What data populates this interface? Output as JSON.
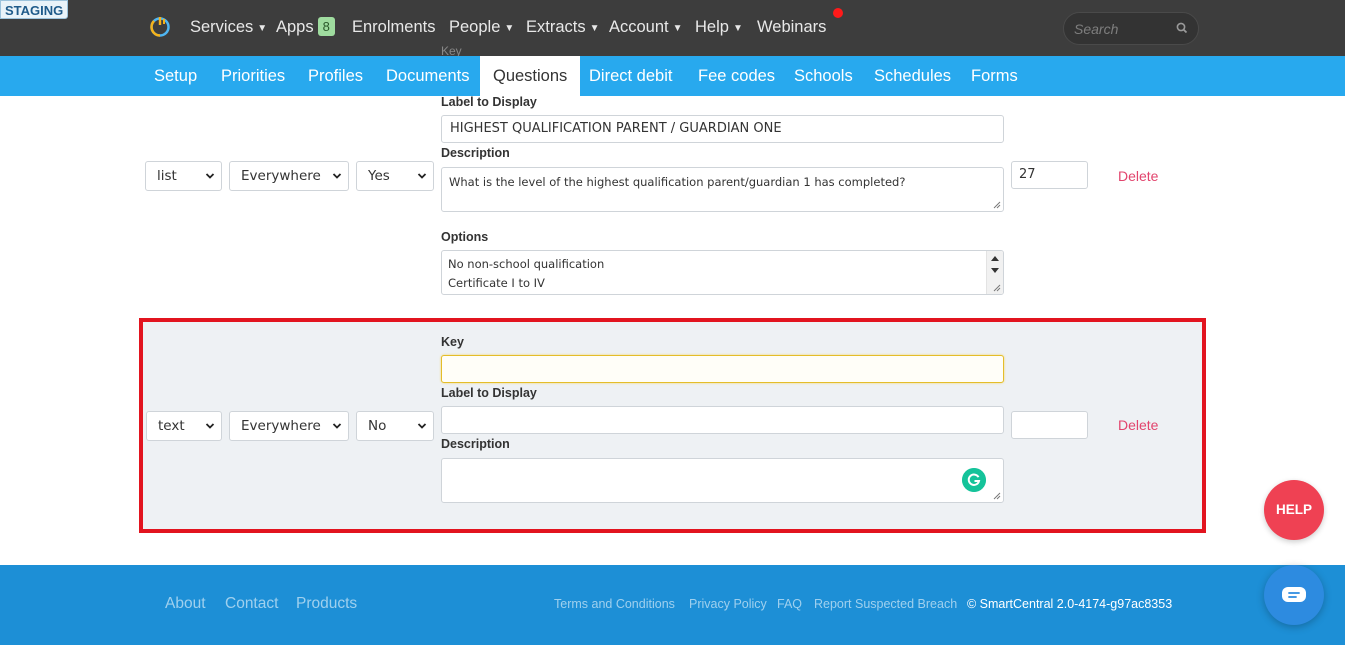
{
  "env_badge": "STAGING",
  "nav": {
    "items": [
      {
        "label": "Services",
        "caret": "▼"
      },
      {
        "label": "Apps",
        "badge": "8"
      },
      {
        "label": "Enrolments"
      },
      {
        "label": "People",
        "caret": "▼"
      },
      {
        "label": "Extracts",
        "caret": "▼"
      },
      {
        "label": "Account",
        "caret": "▼"
      },
      {
        "label": "Help",
        "caret": "▼"
      },
      {
        "label": "Webinars"
      }
    ],
    "search_placeholder": "Search"
  },
  "subnav": {
    "tabs": [
      "Setup",
      "Priorities",
      "Profiles",
      "Documents",
      "Questions",
      "Direct debit",
      "Fee codes",
      "Schools",
      "Schedules",
      "Forms"
    ],
    "active": "Questions"
  },
  "questions": [
    {
      "key_label": "Key",
      "type": "list",
      "scope": "Everywhere",
      "required": "Yes",
      "label_heading": "Label to Display",
      "label_value": "HIGHEST QUALIFICATION PARENT / GUARDIAN ONE",
      "description_heading": "Description",
      "description_value": "What is the level of the highest qualification parent/guardian 1 has completed?",
      "options_heading": "Options",
      "options": [
        "No non-school qualification",
        "Certificate I to IV"
      ],
      "order": "27",
      "delete_label": "Delete"
    },
    {
      "key_label": "Key",
      "key_value": "",
      "type": "text",
      "scope": "Everywhere",
      "required": "No",
      "label_heading": "Label to Display",
      "label_value": "",
      "description_heading": "Description",
      "description_value": "",
      "order": "",
      "delete_label": "Delete"
    }
  ],
  "help_button": "HELP",
  "footer": {
    "links": [
      "About",
      "Contact",
      "Products"
    ],
    "small_links": [
      "Terms and Conditions",
      "Privacy Policy",
      "FAQ",
      "Report Suspected Breach"
    ],
    "copyright": "©  SmartCentral 2.0-4174-g97ac8353"
  },
  "colors": {
    "topbar": "#3d3d3d",
    "subnav": "#28a9ee",
    "footer": "#1d8fd6",
    "delete": "#e2446d",
    "highlight_border": "#e2141f",
    "help": "#ef4153"
  }
}
